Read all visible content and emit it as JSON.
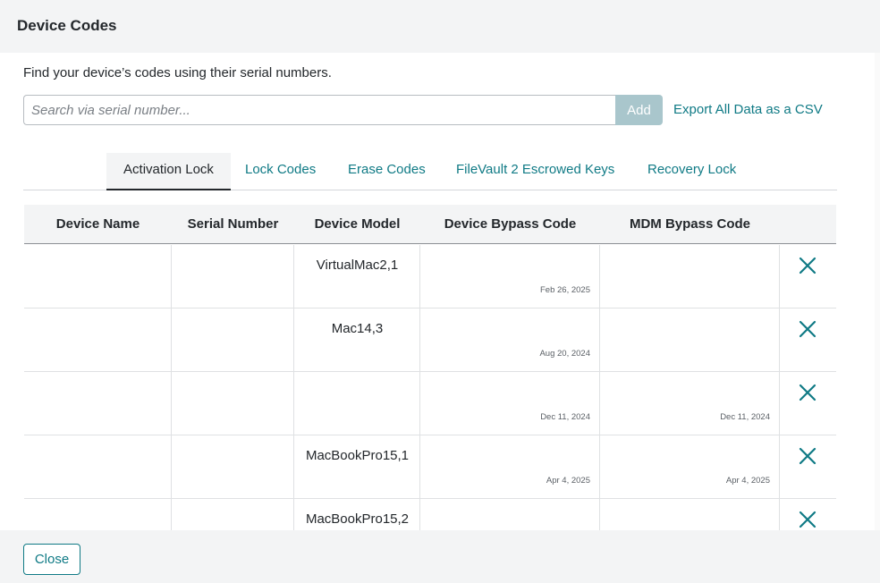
{
  "dialog": {
    "title": "Device Codes"
  },
  "intro": "Find your device’s codes using their serial numbers.",
  "search": {
    "placeholder": "Search via serial number...",
    "value": "",
    "add_label": "Add"
  },
  "export_label": "Export All Data as a CSV",
  "tabs": [
    {
      "label": "Activation Lock",
      "active": true
    },
    {
      "label": "Lock Codes",
      "active": false
    },
    {
      "label": "Erase Codes",
      "active": false
    },
    {
      "label": "FileVault 2 Escrowed Keys",
      "active": false
    },
    {
      "label": "Recovery Lock",
      "active": false
    }
  ],
  "table": {
    "columns": [
      "Device Name",
      "Serial Number",
      "Device Model",
      "Device Bypass Code",
      "MDM Bypass Code"
    ],
    "rows": [
      {
        "device_name": "",
        "serial_number": "",
        "model": "VirtualMac2,1",
        "device_bypass_date": "Feb 26, 2025",
        "mdm_bypass_date": ""
      },
      {
        "device_name": "",
        "serial_number": "",
        "model": "Mac14,3",
        "device_bypass_date": "Aug 20, 2024",
        "mdm_bypass_date": ""
      },
      {
        "device_name": "",
        "serial_number": "",
        "model": "",
        "device_bypass_date": "Dec 11, 2024",
        "mdm_bypass_date": "Dec 11, 2024"
      },
      {
        "device_name": "",
        "serial_number": "",
        "model": "MacBookPro15,1",
        "device_bypass_date": "Apr 4, 2025",
        "mdm_bypass_date": "Apr 4, 2025"
      },
      {
        "device_name": "",
        "serial_number": "",
        "model": "MacBookPro15,2",
        "device_bypass_date": "",
        "mdm_bypass_date": ""
      }
    ],
    "delete_icon": "close-x-icon"
  },
  "footer": {
    "close_label": "Close"
  },
  "colors": {
    "accent": "#0f7a85",
    "header_bg": "#f3f4f5",
    "add_button": "#a9c6cc"
  }
}
